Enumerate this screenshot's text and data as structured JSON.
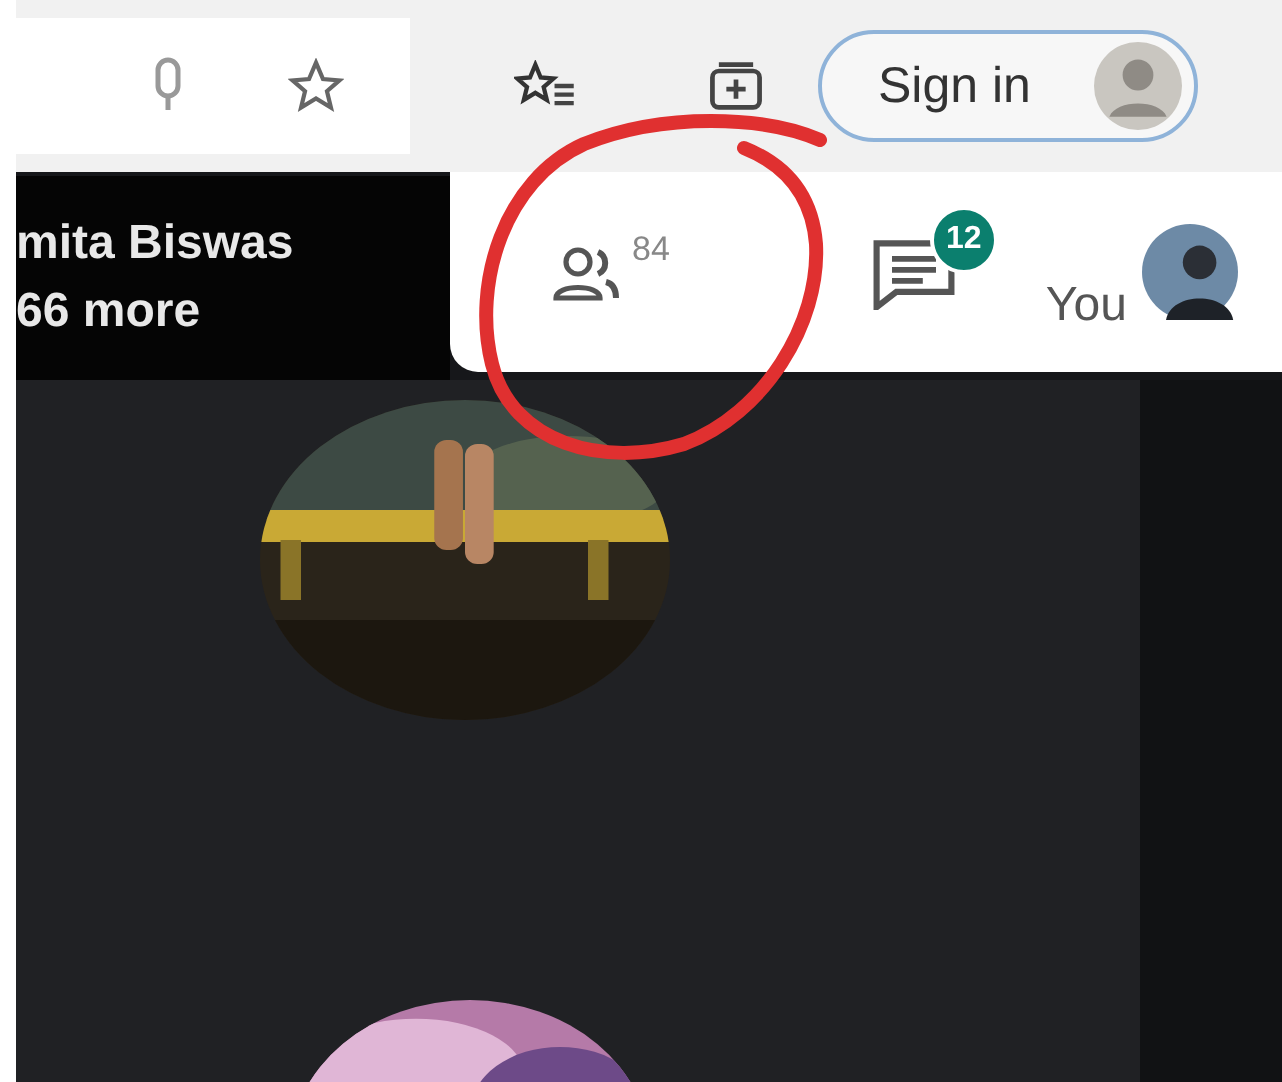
{
  "toolbar": {
    "sign_in": "Sign in"
  },
  "meeting_banner": {
    "lines": [
      "mita Biswas",
      "66 more"
    ]
  },
  "controls": {
    "people_count": "84",
    "chat_badge": "12",
    "self_label": "You"
  }
}
